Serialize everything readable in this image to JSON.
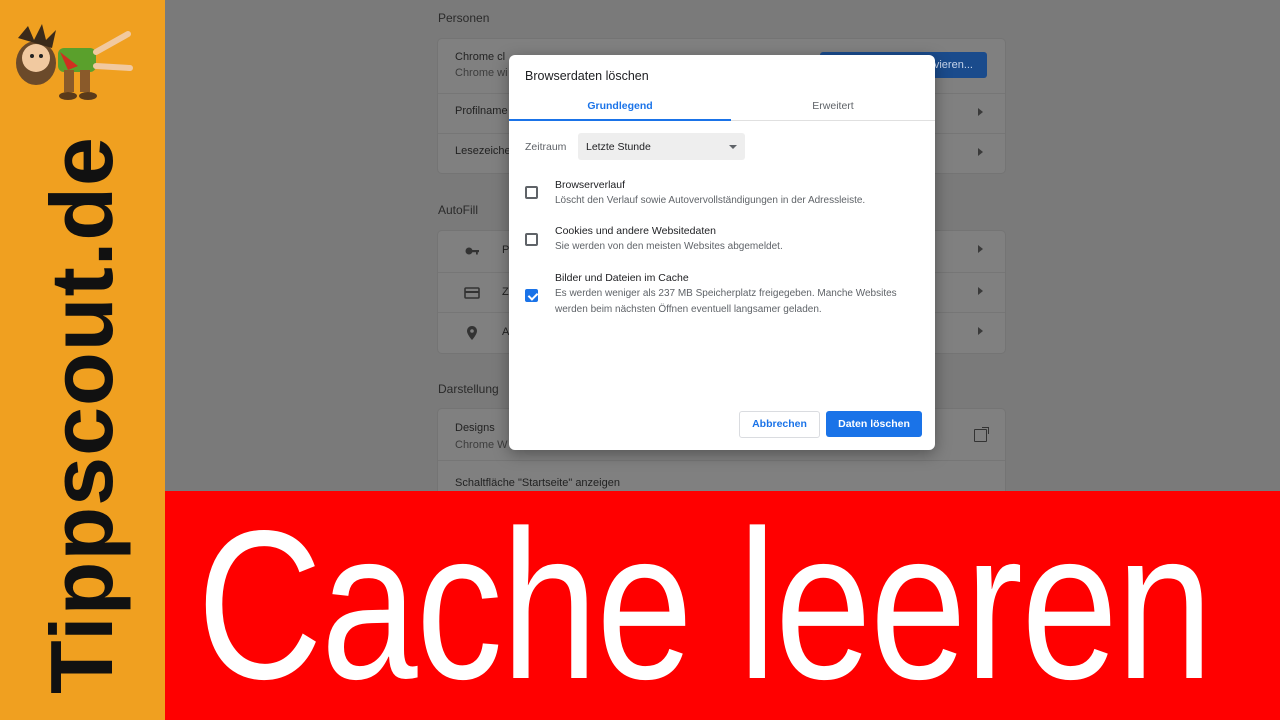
{
  "brand": {
    "text": "Tippscout.de"
  },
  "settings": {
    "personen": {
      "title": "Personen",
      "sync_title": "Chrome cl",
      "sync_sub": "Chrome wi",
      "sync_button": "vieren...",
      "profile": "Profilname",
      "bookmarks": "Lesezeiche"
    },
    "autofill": {
      "title": "AutoFill",
      "passwords": "P",
      "payments": "Z",
      "addresses": "A"
    },
    "darstellung": {
      "title": "Darstellung",
      "designs_title": "Designs",
      "designs_sub": "Chrome W",
      "home_button": "Schaltfläche \"Startseite\" anzeigen"
    }
  },
  "dialog": {
    "title": "Browserdaten löschen",
    "tabs": [
      "Grundlegend",
      "Erweitert"
    ],
    "time_label": "Zeitraum",
    "time_value": "Letzte Stunde",
    "options": [
      {
        "title": "Browserverlauf",
        "desc": "Löscht den Verlauf sowie Autovervollständigungen in der Adressleiste.",
        "checked": false
      },
      {
        "title": "Cookies und andere Websitedaten",
        "desc": "Sie werden von den meisten Websites abgemeldet.",
        "checked": false
      },
      {
        "title": "Bilder und Dateien im Cache",
        "desc": "Es werden weniger als 237 MB Speicherplatz freigegeben. Manche Websites werden beim nächsten Öffnen eventuell langsamer geladen.",
        "checked": true
      }
    ],
    "cancel": "Abbrechen",
    "confirm": "Daten löschen"
  },
  "banner": {
    "text": "Cache leeren"
  },
  "colors": {
    "accent": "#1a73e8",
    "banner": "#ff0000",
    "brand": "#f0a020"
  }
}
